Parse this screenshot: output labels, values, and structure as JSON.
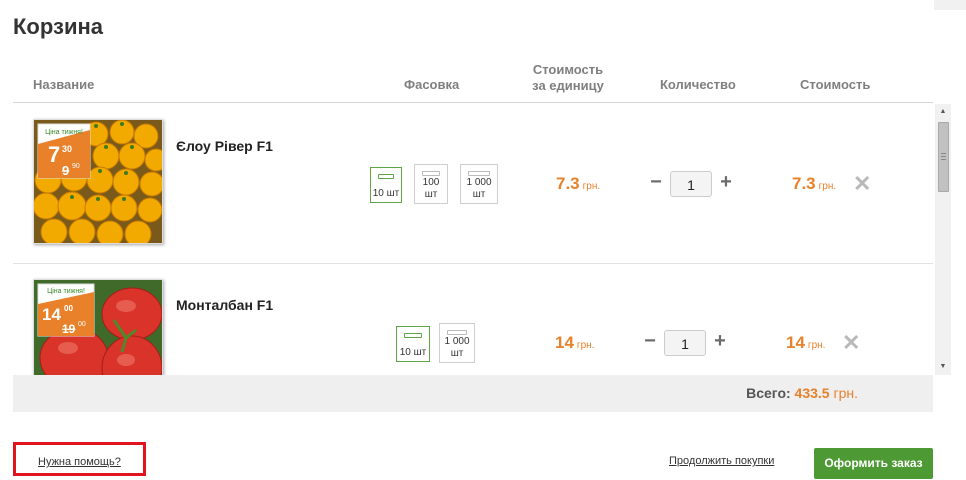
{
  "page": {
    "title": "Корзина"
  },
  "columns": {
    "name": "Название",
    "packing": "Фасовка",
    "unit_price_line1": "Стоимость",
    "unit_price_line2": "за единицу",
    "quantity": "Количество",
    "cost": "Стоимость"
  },
  "items": [
    {
      "name": "Єлоу Рівер F1",
      "image_icon": "yellow-tomatoes-product-photo",
      "image_badge": {
        "label": "Ціна тижня!",
        "new_price_main": "7",
        "new_price_cents": "30",
        "old_price_main": "9",
        "old_price_cents": "90"
      },
      "packs": [
        {
          "line1": "10 шт",
          "line2": "",
          "selected": true
        },
        {
          "line1": "100",
          "line2": "шт",
          "selected": false
        },
        {
          "line1": "1 000",
          "line2": "шт",
          "selected": false
        }
      ],
      "unit_price": "7.3",
      "currency": "грн.",
      "quantity": "1",
      "cost": "7.3"
    },
    {
      "name": "Монталбан F1",
      "image_icon": "red-tomatoes-product-photo",
      "image_badge": {
        "label": "Ціна тижня!",
        "new_price_main": "14",
        "new_price_cents": "00",
        "old_price_main": "19",
        "old_price_cents": "00"
      },
      "packs": [
        {
          "line1": "10 шт",
          "line2": "",
          "selected": true
        },
        {
          "line1": "1 000",
          "line2": "шт",
          "selected": false
        }
      ],
      "unit_price": "14",
      "currency": "грн.",
      "quantity": "1",
      "cost": "14"
    }
  ],
  "quantity_controls": {
    "minus": "−",
    "plus": "+",
    "remove": "✕"
  },
  "total": {
    "label": "Всего:",
    "amount": "433.5",
    "currency": "грн."
  },
  "footer": {
    "help_link": "Нужна помощь?",
    "continue_link": "Продолжить покупки",
    "checkout_button": "Оформить заказ"
  },
  "colors": {
    "accent_price": "#e8812a",
    "checkout_green": "#4d9a35",
    "highlight_red": "#e0141c"
  }
}
